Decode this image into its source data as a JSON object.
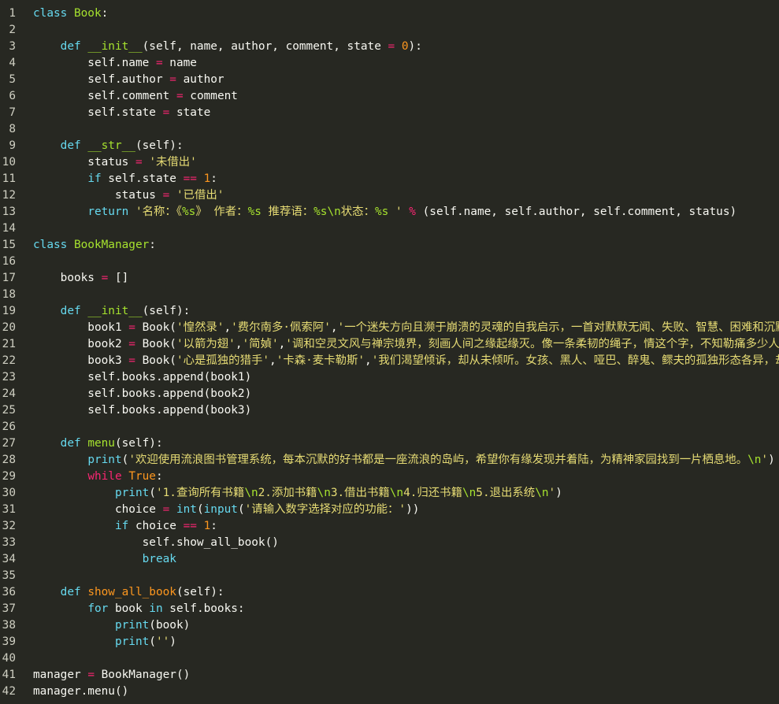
{
  "editor": {
    "lines": [
      {
        "n": "1",
        "tokens": [
          {
            "t": "class ",
            "c": "kw"
          },
          {
            "t": "Book",
            "c": "cls"
          },
          {
            "t": ":",
            "c": ""
          }
        ]
      },
      {
        "n": "2",
        "tokens": []
      },
      {
        "n": "3",
        "tokens": [
          {
            "t": "    ",
            "c": ""
          },
          {
            "t": "def ",
            "c": "kw"
          },
          {
            "t": "__init__",
            "c": "fn"
          },
          {
            "t": "(self, name, author, comment, state ",
            "c": ""
          },
          {
            "t": "=",
            "c": "op"
          },
          {
            "t": " ",
            "c": ""
          },
          {
            "t": "0",
            "c": "num"
          },
          {
            "t": "):",
            "c": ""
          }
        ]
      },
      {
        "n": "4",
        "tokens": [
          {
            "t": "        self.name ",
            "c": ""
          },
          {
            "t": "=",
            "c": "op"
          },
          {
            "t": " name",
            "c": ""
          }
        ]
      },
      {
        "n": "5",
        "tokens": [
          {
            "t": "        self.author ",
            "c": ""
          },
          {
            "t": "=",
            "c": "op"
          },
          {
            "t": " author",
            "c": ""
          }
        ]
      },
      {
        "n": "6",
        "tokens": [
          {
            "t": "        self.comment ",
            "c": ""
          },
          {
            "t": "=",
            "c": "op"
          },
          {
            "t": " comment",
            "c": ""
          }
        ]
      },
      {
        "n": "7",
        "tokens": [
          {
            "t": "        self.state ",
            "c": ""
          },
          {
            "t": "=",
            "c": "op"
          },
          {
            "t": " state",
            "c": ""
          }
        ]
      },
      {
        "n": "8",
        "tokens": []
      },
      {
        "n": "9",
        "tokens": [
          {
            "t": "    ",
            "c": ""
          },
          {
            "t": "def ",
            "c": "kw"
          },
          {
            "t": "__str__",
            "c": "fn"
          },
          {
            "t": "(self):",
            "c": ""
          }
        ]
      },
      {
        "n": "10",
        "tokens": [
          {
            "t": "        status ",
            "c": ""
          },
          {
            "t": "=",
            "c": "op"
          },
          {
            "t": " ",
            "c": ""
          },
          {
            "t": "'未借出'",
            "c": "str"
          }
        ]
      },
      {
        "n": "11",
        "tokens": [
          {
            "t": "        ",
            "c": ""
          },
          {
            "t": "if",
            "c": "kw"
          },
          {
            "t": " self.state ",
            "c": ""
          },
          {
            "t": "==",
            "c": "op"
          },
          {
            "t": " ",
            "c": ""
          },
          {
            "t": "1",
            "c": "num"
          },
          {
            "t": ":",
            "c": ""
          }
        ]
      },
      {
        "n": "12",
        "tokens": [
          {
            "t": "            status ",
            "c": ""
          },
          {
            "t": "=",
            "c": "op"
          },
          {
            "t": " ",
            "c": ""
          },
          {
            "t": "'已借出'",
            "c": "str"
          }
        ]
      },
      {
        "n": "13",
        "tokens": [
          {
            "t": "        ",
            "c": ""
          },
          {
            "t": "return",
            "c": "kw"
          },
          {
            "t": " ",
            "c": ""
          },
          {
            "t": "'名称：《",
            "c": "str"
          },
          {
            "t": "%s",
            "c": "esc2"
          },
          {
            "t": "》 作者：",
            "c": "str"
          },
          {
            "t": "%s",
            "c": "esc2"
          },
          {
            "t": " 推荐语：",
            "c": "str"
          },
          {
            "t": "%s",
            "c": "esc2"
          },
          {
            "t": "\\n",
            "c": "esc2"
          },
          {
            "t": "状态：",
            "c": "str"
          },
          {
            "t": "%s",
            "c": "esc2"
          },
          {
            "t": " '",
            "c": "str"
          },
          {
            "t": " ",
            "c": ""
          },
          {
            "t": "%",
            "c": "op"
          },
          {
            "t": " (self.name, self.author, self.comment, status)",
            "c": ""
          }
        ]
      },
      {
        "n": "14",
        "tokens": []
      },
      {
        "n": "15",
        "tokens": [
          {
            "t": "class ",
            "c": "kw"
          },
          {
            "t": "BookManager",
            "c": "cls"
          },
          {
            "t": ":",
            "c": ""
          }
        ]
      },
      {
        "n": "16",
        "tokens": []
      },
      {
        "n": "17",
        "tokens": [
          {
            "t": "    books ",
            "c": ""
          },
          {
            "t": "=",
            "c": "op"
          },
          {
            "t": " []",
            "c": ""
          }
        ]
      },
      {
        "n": "18",
        "tokens": []
      },
      {
        "n": "19",
        "tokens": [
          {
            "t": "    ",
            "c": ""
          },
          {
            "t": "def ",
            "c": "kw"
          },
          {
            "t": "__init__",
            "c": "fn"
          },
          {
            "t": "(self):",
            "c": ""
          }
        ]
      },
      {
        "n": "20",
        "tokens": [
          {
            "t": "        book1 ",
            "c": ""
          },
          {
            "t": "=",
            "c": "op"
          },
          {
            "t": " Book(",
            "c": ""
          },
          {
            "t": "'惶然录'",
            "c": "str"
          },
          {
            "t": ",",
            "c": ""
          },
          {
            "t": "'费尔南多·佩索阿'",
            "c": "str"
          },
          {
            "t": ",",
            "c": ""
          },
          {
            "t": "'一个迷失方向且濒于崩溃的灵魂的自我启示，一首对默默无闻、失败、智慧、困难和沉默",
            "c": "str"
          }
        ]
      },
      {
        "n": "21",
        "tokens": [
          {
            "t": "        book2 ",
            "c": ""
          },
          {
            "t": "=",
            "c": "op"
          },
          {
            "t": " Book(",
            "c": ""
          },
          {
            "t": "'以箭为翅'",
            "c": "str"
          },
          {
            "t": ",",
            "c": ""
          },
          {
            "t": "'简媜'",
            "c": "str"
          },
          {
            "t": ",",
            "c": ""
          },
          {
            "t": "'调和空灵文风与禅宗境界，刻画人间之缘起缘灭。像一条柔韧的绳子，情这个字，不知勒痛多少人的",
            "c": "str"
          }
        ]
      },
      {
        "n": "22",
        "tokens": [
          {
            "t": "        book3 ",
            "c": ""
          },
          {
            "t": "=",
            "c": "op"
          },
          {
            "t": " Book(",
            "c": ""
          },
          {
            "t": "'心是孤独的猎手'",
            "c": "str"
          },
          {
            "t": ",",
            "c": ""
          },
          {
            "t": "'卡森·麦卡勒斯'",
            "c": "str"
          },
          {
            "t": ",",
            "c": ""
          },
          {
            "t": "'我们渴望倾诉，却从未倾听。女孩、黑人、哑巴、醉鬼、鳏夫的孤独形态各异，却都",
            "c": "str"
          }
        ]
      },
      {
        "n": "23",
        "tokens": [
          {
            "t": "        self.books.append(book1)",
            "c": ""
          }
        ]
      },
      {
        "n": "24",
        "tokens": [
          {
            "t": "        self.books.append(book2)",
            "c": ""
          }
        ]
      },
      {
        "n": "25",
        "tokens": [
          {
            "t": "        self.books.append(book3)",
            "c": ""
          }
        ]
      },
      {
        "n": "26",
        "tokens": []
      },
      {
        "n": "27",
        "tokens": [
          {
            "t": "    ",
            "c": ""
          },
          {
            "t": "def ",
            "c": "kw"
          },
          {
            "t": "menu",
            "c": "fn"
          },
          {
            "t": "(self):",
            "c": ""
          }
        ]
      },
      {
        "n": "28",
        "tokens": [
          {
            "t": "        ",
            "c": ""
          },
          {
            "t": "print",
            "c": "kw"
          },
          {
            "t": "(",
            "c": ""
          },
          {
            "t": "'欢迎使用流浪图书管理系统，每本沉默的好书都是一座流浪的岛屿，希望你有缘发现并着陆，为精神家园找到一片栖息地。",
            "c": "str"
          },
          {
            "t": "\\n",
            "c": "esc2"
          },
          {
            "t": "'",
            "c": "str"
          },
          {
            "t": ")",
            "c": ""
          }
        ]
      },
      {
        "n": "29",
        "tokens": [
          {
            "t": "        ",
            "c": ""
          },
          {
            "t": "while",
            "c": "op"
          },
          {
            "t": " ",
            "c": ""
          },
          {
            "t": "True",
            "c": "bi"
          },
          {
            "t": ":",
            "c": ""
          }
        ]
      },
      {
        "n": "30",
        "tokens": [
          {
            "t": "            ",
            "c": ""
          },
          {
            "t": "print",
            "c": "kw"
          },
          {
            "t": "(",
            "c": ""
          },
          {
            "t": "'1.查询所有书籍",
            "c": "str"
          },
          {
            "t": "\\n",
            "c": "esc2"
          },
          {
            "t": "2.添加书籍",
            "c": "str"
          },
          {
            "t": "\\n",
            "c": "esc2"
          },
          {
            "t": "3.借出书籍",
            "c": "str"
          },
          {
            "t": "\\n",
            "c": "esc2"
          },
          {
            "t": "4.归还书籍",
            "c": "str"
          },
          {
            "t": "\\n",
            "c": "esc2"
          },
          {
            "t": "5.退出系统",
            "c": "str"
          },
          {
            "t": "\\n",
            "c": "esc2"
          },
          {
            "t": "'",
            "c": "str"
          },
          {
            "t": ")",
            "c": ""
          }
        ]
      },
      {
        "n": "31",
        "tokens": [
          {
            "t": "            choice ",
            "c": ""
          },
          {
            "t": "=",
            "c": "op"
          },
          {
            "t": " ",
            "c": ""
          },
          {
            "t": "int",
            "c": "kw"
          },
          {
            "t": "(",
            "c": ""
          },
          {
            "t": "input",
            "c": "kw"
          },
          {
            "t": "(",
            "c": ""
          },
          {
            "t": "'请输入数字选择对应的功能：'",
            "c": "str"
          },
          {
            "t": "))",
            "c": ""
          }
        ]
      },
      {
        "n": "32",
        "tokens": [
          {
            "t": "            ",
            "c": ""
          },
          {
            "t": "if",
            "c": "kw"
          },
          {
            "t": " choice ",
            "c": ""
          },
          {
            "t": "==",
            "c": "op"
          },
          {
            "t": " ",
            "c": ""
          },
          {
            "t": "1",
            "c": "num"
          },
          {
            "t": ":",
            "c": ""
          }
        ]
      },
      {
        "n": "33",
        "tokens": [
          {
            "t": "                self.show_all_book()",
            "c": ""
          }
        ]
      },
      {
        "n": "34",
        "tokens": [
          {
            "t": "                ",
            "c": ""
          },
          {
            "t": "break",
            "c": "kw"
          }
        ]
      },
      {
        "n": "35",
        "tokens": []
      },
      {
        "n": "36",
        "tokens": [
          {
            "t": "    ",
            "c": ""
          },
          {
            "t": "def ",
            "c": "kw"
          },
          {
            "t": "show_all_book",
            "c": "bi"
          },
          {
            "t": "(self):",
            "c": ""
          }
        ]
      },
      {
        "n": "37",
        "tokens": [
          {
            "t": "        ",
            "c": ""
          },
          {
            "t": "for",
            "c": "kw"
          },
          {
            "t": " book ",
            "c": ""
          },
          {
            "t": "in",
            "c": "kw"
          },
          {
            "t": " self.books:",
            "c": ""
          }
        ]
      },
      {
        "n": "38",
        "tokens": [
          {
            "t": "            ",
            "c": ""
          },
          {
            "t": "print",
            "c": "kw"
          },
          {
            "t": "(book)",
            "c": ""
          }
        ]
      },
      {
        "n": "39",
        "tokens": [
          {
            "t": "            ",
            "c": ""
          },
          {
            "t": "print",
            "c": "kw"
          },
          {
            "t": "(",
            "c": ""
          },
          {
            "t": "''",
            "c": "str"
          },
          {
            "t": ")",
            "c": ""
          }
        ]
      },
      {
        "n": "40",
        "tokens": []
      },
      {
        "n": "41",
        "tokens": [
          {
            "t": "manager ",
            "c": ""
          },
          {
            "t": "=",
            "c": "op"
          },
          {
            "t": " BookManager()",
            "c": ""
          }
        ]
      },
      {
        "n": "42",
        "tokens": [
          {
            "t": "manager.menu()",
            "c": ""
          }
        ]
      }
    ]
  }
}
